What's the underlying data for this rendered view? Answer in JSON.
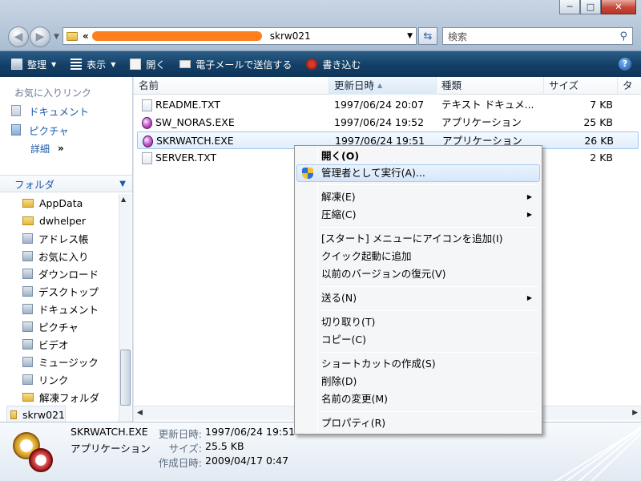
{
  "window": {
    "minimize": "─",
    "maximize": "□",
    "close": "✕"
  },
  "address": {
    "chevron": "«",
    "path_tail": "skrw021",
    "search_placeholder": "検索"
  },
  "toolbar": {
    "organize": "整理",
    "views": "表示",
    "open": "開く",
    "email": "電子メールで送信する",
    "burn": "書き込む",
    "help": "?"
  },
  "left_pane": {
    "favorites_header": "お気に入りリンク",
    "favorites": [
      "ドキュメント",
      "ピクチャ"
    ],
    "more": "詳細",
    "more_chevron": "»",
    "folders_header": "フォルダ",
    "tree": [
      "AppData",
      "dwhelper",
      "アドレス帳",
      "お気に入り",
      "ダウンロード",
      "デスクトップ",
      "ドキュメント",
      "ピクチャ",
      "ビデオ",
      "ミュージック",
      "リンク",
      "解凍フォルダ",
      "skrw021"
    ]
  },
  "columns": [
    "名前",
    "更新日時",
    "種類",
    "サイズ",
    "タ"
  ],
  "files": [
    {
      "name": "README.TXT",
      "date": "1997/06/24 20:07",
      "type": "テキスト ドキュメ...",
      "size": "7 KB",
      "icon": "text-file"
    },
    {
      "name": "SW_NORAS.EXE",
      "date": "1997/06/24 19:52",
      "type": "アプリケーション",
      "size": "25 KB",
      "icon": "exe-file"
    },
    {
      "name": "SKRWATCH.EXE",
      "date": "1997/06/24 19:51",
      "type": "アプリケーション",
      "size": "26 KB",
      "icon": "exe-file"
    },
    {
      "name": "SERVER.TXT",
      "date": "",
      "type": "",
      "size": "2 KB",
      "icon": "text-file"
    }
  ],
  "context_menu": {
    "open": "開く(O)",
    "run_as_admin": "管理者として実行(A)...",
    "extract": "解凍(E)",
    "compress": "圧縮(C)",
    "add_start": "[スタート] メニューにアイコンを追加(I)",
    "add_quick": "クイック起動に追加",
    "restore": "以前のバージョンの復元(V)",
    "send_to": "送る(N)",
    "cut": "切り取り(T)",
    "copy": "コピー(C)",
    "shortcut": "ショートカットの作成(S)",
    "delete": "削除(D)",
    "rename": "名前の変更(M)",
    "properties": "プロパティ(R)"
  },
  "details": {
    "name": "SKRWATCH.EXE",
    "type": "アプリケーション",
    "modified_label": "更新日時:",
    "modified": "1997/06/24 19:51",
    "size_label": "サイズ:",
    "size": "25.5 KB",
    "created_label": "作成日時:",
    "created": "2009/04/17 0:47"
  }
}
